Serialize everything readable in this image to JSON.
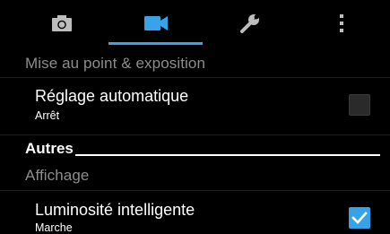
{
  "tabs": [
    {
      "icon": "camera-icon",
      "label": ""
    },
    {
      "icon": "video-camera-icon",
      "label": ""
    },
    {
      "icon": "wrench-icon",
      "label": ""
    },
    {
      "icon": "more-vertical-icon",
      "label": ""
    }
  ],
  "active_tab_index": 1,
  "colors": {
    "accent": "#38a3e8",
    "background": "#000000",
    "section_header_text": "#8c8c8c"
  },
  "sections": {
    "focus_exposure_header": "Mise au point & exposition",
    "auto_setting": {
      "title": "Réglage automatique",
      "summary": "Arrêt",
      "checked": false
    },
    "category_title": "Autres",
    "display_header": "Affichage",
    "smart_brightness": {
      "title": "Luminosité intelligente",
      "summary": "Marche",
      "checked": true
    }
  }
}
